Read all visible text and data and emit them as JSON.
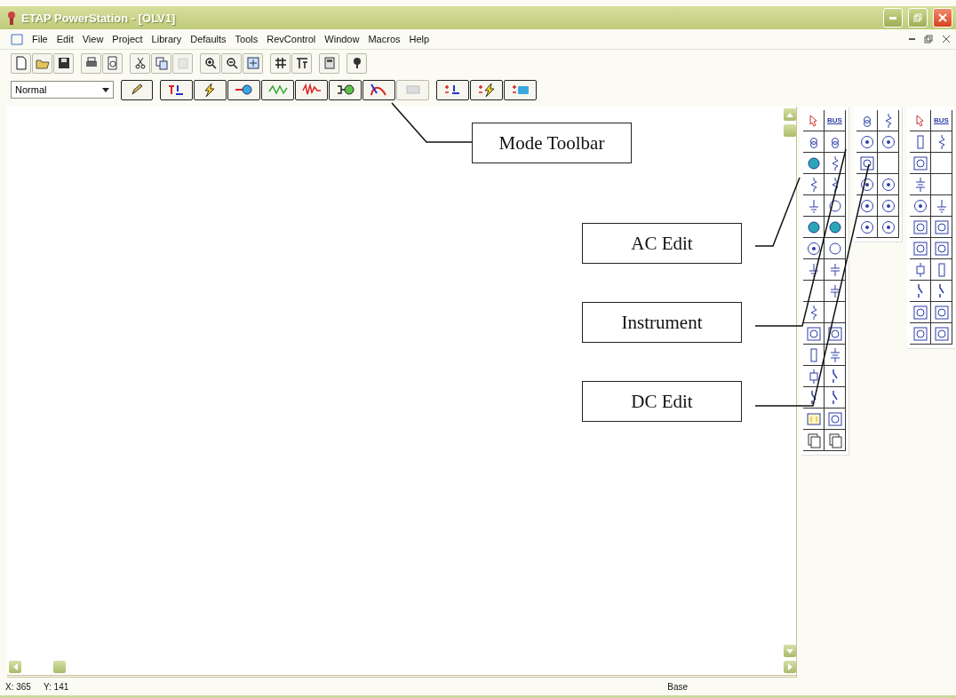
{
  "window": {
    "title": "ETAP PowerStation - [OLV1]"
  },
  "menu": [
    "File",
    "Edit",
    "View",
    "Project",
    "Library",
    "Defaults",
    "Tools",
    "RevControl",
    "Window",
    "Macros",
    "Help"
  ],
  "mode_select": {
    "value": "Normal"
  },
  "ac_edit": {
    "bus_label": "BUS"
  },
  "dc_edit": {
    "bus_label": "BUS"
  },
  "callouts": [
    {
      "text": "Mode Toolbar"
    },
    {
      "text": "AC Edit"
    },
    {
      "text": "Instrument"
    },
    {
      "text": "DC Edit"
    }
  ],
  "status_bar": {
    "x": "X: 365",
    "y": "Y: 141",
    "mode": "Base"
  }
}
